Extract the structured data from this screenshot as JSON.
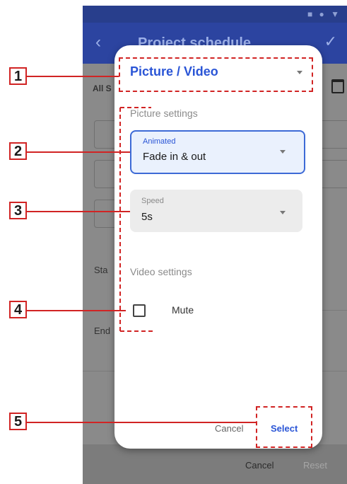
{
  "status_bar": {
    "icons": "■ ● ▼"
  },
  "app_bar": {
    "back_icon": "‹",
    "title": "Project schedule",
    "confirm_icon": "✓"
  },
  "background": {
    "all_label": "All S",
    "start_label": "Sta",
    "end_label": "End",
    "bottom_cancel": "Cancel",
    "bottom_reset": "Reset"
  },
  "dialog": {
    "type_value": "Picture / Video",
    "picture_section": "Picture settings",
    "animated_label": "Animated",
    "animated_value": "Fade in & out",
    "speed_label": "Speed",
    "speed_value": "5s",
    "video_section": "Video settings",
    "mute_label": "Mute",
    "mute_checked": false,
    "cancel_label": "Cancel",
    "select_label": "Select"
  },
  "callouts": [
    "1",
    "2",
    "3",
    "4",
    "5"
  ],
  "colors": {
    "accent": "#2a55d6",
    "callout": "#d12424",
    "app_bar": "#2c44a0"
  }
}
